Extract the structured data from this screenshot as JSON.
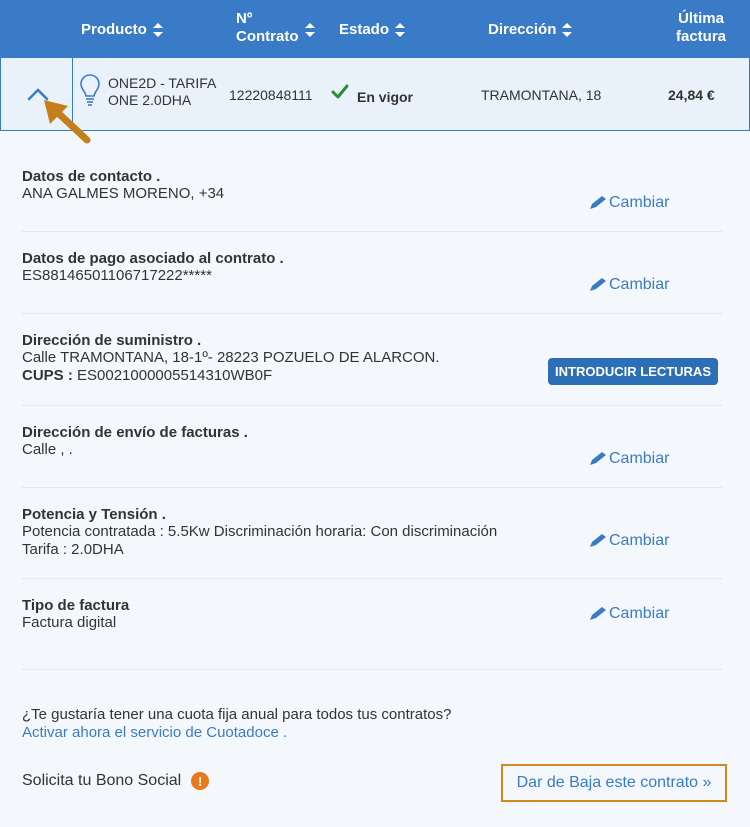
{
  "table_header": {
    "producto": "Producto",
    "contrato_line1": "Nº",
    "contrato_line2": "Contrato",
    "estado": "Estado",
    "direccion": "Dirección",
    "factura_line1": "Última",
    "factura_line2": "factura"
  },
  "contract_row": {
    "product_line1": "ONE2D - TARIFA",
    "product_line2": "ONE 2.0DHA",
    "contract_number": "12220848111",
    "status": "En vigor",
    "address": "TRAMONTANA, 18",
    "last_invoice": "24,84 €"
  },
  "sections": {
    "contacto": {
      "title": "Datos de contacto .",
      "text": "ANA GALMES MORENO, +34",
      "action": "Cambiar"
    },
    "pago": {
      "title": "Datos de pago asociado al contrato .",
      "text": "ES88146501106717222*****",
      "action": "Cambiar"
    },
    "suministro": {
      "title": "Dirección de suministro .",
      "text": "Calle TRAMONTANA, 18-1º- 28223 POZUELO DE ALARCON.",
      "cups_label": "CUPS :",
      "cups_value": "ES0021000005514310WB0F",
      "action": "INTRODUCIR LECTURAS"
    },
    "envio": {
      "title": "Dirección de envío de facturas .",
      "text": "Calle , .",
      "action": "Cambiar"
    },
    "potencia": {
      "title": "Potencia y Tensión .",
      "text": "Potencia contratada : 5.5Kw Discriminación horaria: Con discriminación",
      "text2": "Tarifa : 2.0DHA",
      "action": "Cambiar"
    },
    "tipo": {
      "title": "Tipo de factura",
      "text": "Factura digital",
      "action": "Cambiar"
    }
  },
  "cuota": {
    "question": "¿Te gustaría tener una cuota fija anual para todos tus contratos?",
    "link": "Activar ahora el servicio de Cuotadoce ."
  },
  "bono": {
    "text": "Solicita tu Bono Social",
    "info_icon": "!"
  },
  "baja": {
    "label": "Dar de Baja este contrato »"
  },
  "colors": {
    "header_bg": "#3a7bc8",
    "accent_orange": "#d4891d",
    "status_green": "#2e8b3a"
  }
}
